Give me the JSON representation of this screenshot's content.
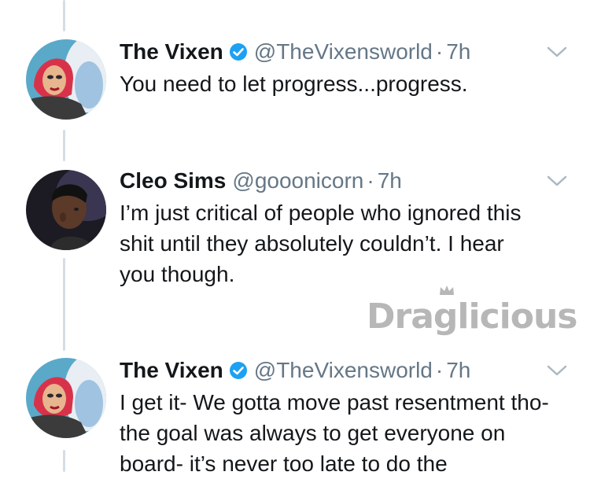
{
  "colors": {
    "thread_line": "#d5dde4",
    "verified": "#1da1f2",
    "secondary_text": "#657786",
    "caret": "#aab8c2",
    "watermark": "#b7b7b7"
  },
  "tweets": [
    {
      "name": "The Vixen",
      "verified": true,
      "handle": "@TheVixensworld",
      "separator": "·",
      "time": "7h",
      "text": "You need to let progress...progress."
    },
    {
      "name": "Cleo Sims",
      "verified": false,
      "handle": "@gooonicorn",
      "separator": "·",
      "time": "7h",
      "text": "I’m just critical of people who ignored this shit until they absolutely couldn’t. I hear you though."
    },
    {
      "name": "The Vixen",
      "verified": true,
      "handle": "@TheVixensworld",
      "separator": "·",
      "time": "7h",
      "text": "I get it- We gotta move past resentment tho- the goal was always to get everyone on board- it’s never too late to do the"
    }
  ],
  "watermark": {
    "text": "Draglicious"
  }
}
